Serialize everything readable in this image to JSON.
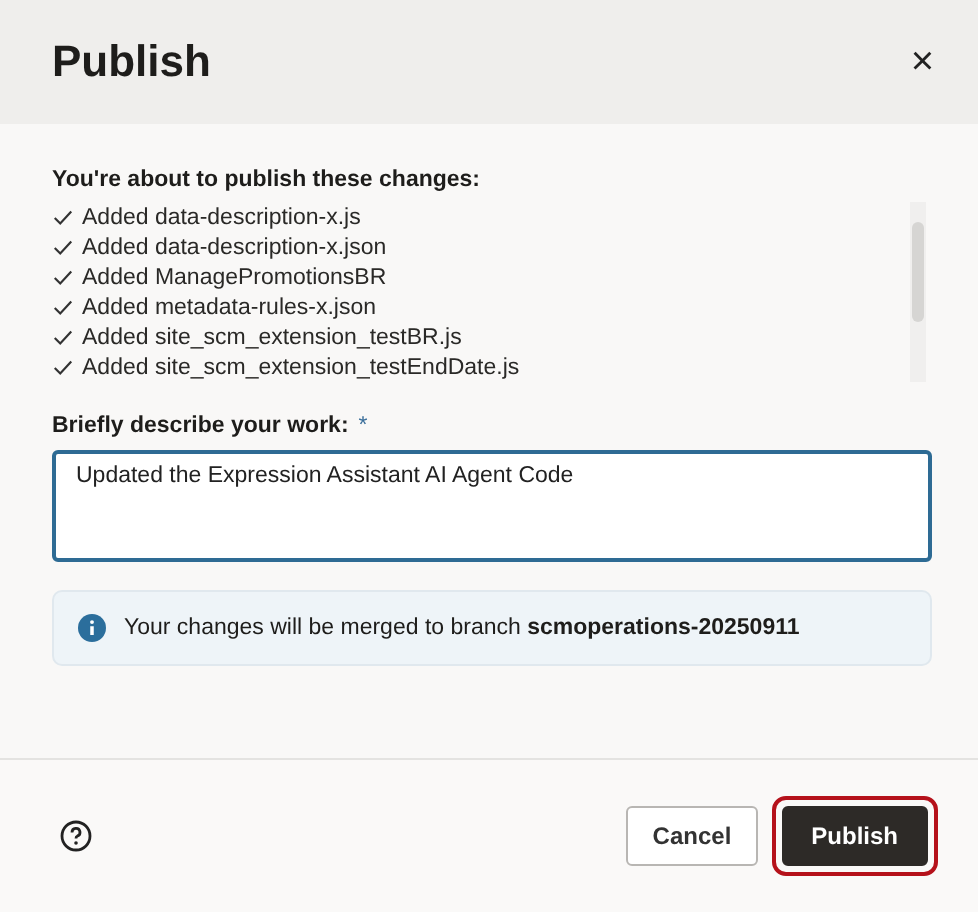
{
  "dialog": {
    "title": "Publish",
    "close": "×"
  },
  "changes": {
    "heading": "You're about to publish these changes:",
    "items": [
      {
        "text": "Added data-description-x.js"
      },
      {
        "text": "Added data-description-x.json"
      },
      {
        "text": "Added ManagePromotionsBR"
      },
      {
        "text": "Added metadata-rules-x.json"
      },
      {
        "text": "Added site_scm_extension_testBR.js"
      },
      {
        "text": "Added site_scm_extension_testEndDate.js"
      }
    ]
  },
  "description": {
    "label": "Briefly describe your work:",
    "required_mark": "*",
    "value": "Updated the Expression Assistant AI Agent Code"
  },
  "info": {
    "text": "Your changes will be merged to branch **scmoperations-20250911**"
  },
  "footer": {
    "buttons": [
      {
        "label": "Cancel",
        "kind": "secondary",
        "highlighted": false
      },
      {
        "label": "Publish",
        "kind": "primary",
        "highlighted": true
      }
    ]
  }
}
